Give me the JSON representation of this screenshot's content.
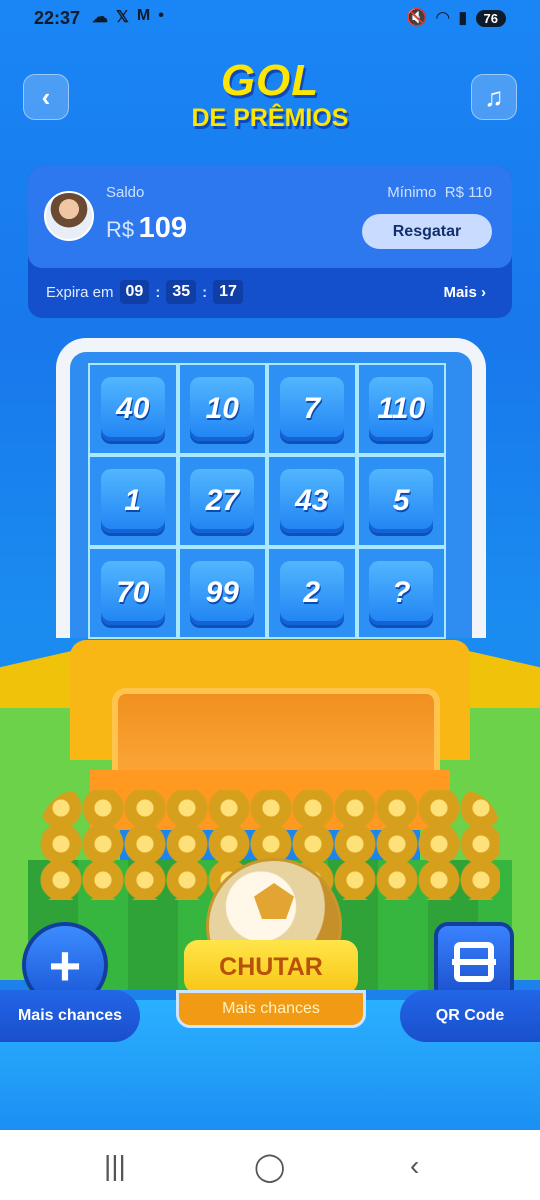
{
  "status_bar": {
    "time": "22:37",
    "left_icons": [
      "cloud-icon",
      "x-icon",
      "gmail-icon",
      "dot-icon"
    ],
    "right_icons": [
      "mute-icon",
      "wifi-icon",
      "signal-icon"
    ],
    "battery": "76"
  },
  "header": {
    "title_line1": "GOL",
    "title_line2": "DE PRÊMIOS"
  },
  "balance": {
    "saldo_label": "Saldo",
    "currency": "R$",
    "amount": "109",
    "minimo_label": "Mínimo",
    "minimo_value": "R$ 110",
    "resgatar_label": "Resgatar",
    "expira_label": "Expira em",
    "timer": {
      "hours": "09",
      "minutes": "35",
      "seconds": "17"
    },
    "mais_label": "Mais"
  },
  "goal_tiles": [
    "40",
    "10",
    "7",
    "110",
    "1",
    "27",
    "43",
    "5",
    "70",
    "99",
    "2",
    "?"
  ],
  "controls": {
    "chutar_label": "CHUTAR",
    "chutar_sub": "Mais chances",
    "left_button": "Mais chances",
    "right_button": "QR Code"
  },
  "colors": {
    "background": "#1a86f5",
    "accent_yellow": "#ffe600",
    "button_orange": "#f29a14"
  }
}
